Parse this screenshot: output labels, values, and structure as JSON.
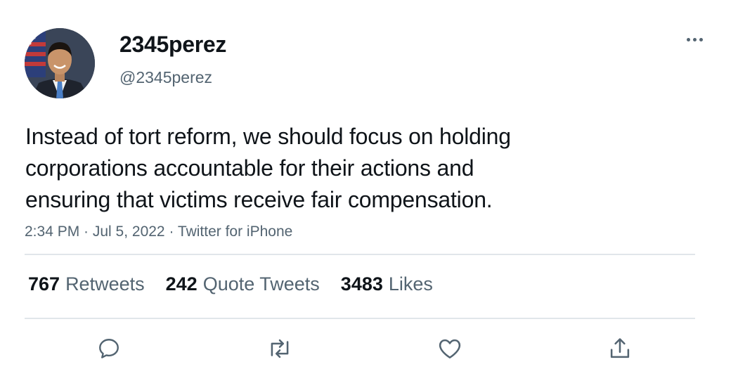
{
  "user": {
    "display_name": "2345perez",
    "handle": "@2345perez"
  },
  "tweet": {
    "lines": [
      "Instead of tort reform, we should focus on holding",
      "corporations accountable for their actions and",
      "ensuring that victims receive fair compensation."
    ],
    "meta": "2:34 PM · Jul 5, 2022 · Twitter for iPhone"
  },
  "stats": {
    "retweets": {
      "count": "767",
      "label": "Retweets"
    },
    "quotes": {
      "count": "242",
      "label": "Quote Tweets"
    },
    "likes": {
      "count": "3483",
      "label": "Likes"
    }
  },
  "icons": {
    "more": "more-horizontal-icon",
    "reply": "reply-icon",
    "retweet": "retweet-icon",
    "like": "heart-icon",
    "share": "share-icon"
  },
  "colors": {
    "text": "#0f1419",
    "secondary": "#536471",
    "divider": "#e1e6ea"
  }
}
